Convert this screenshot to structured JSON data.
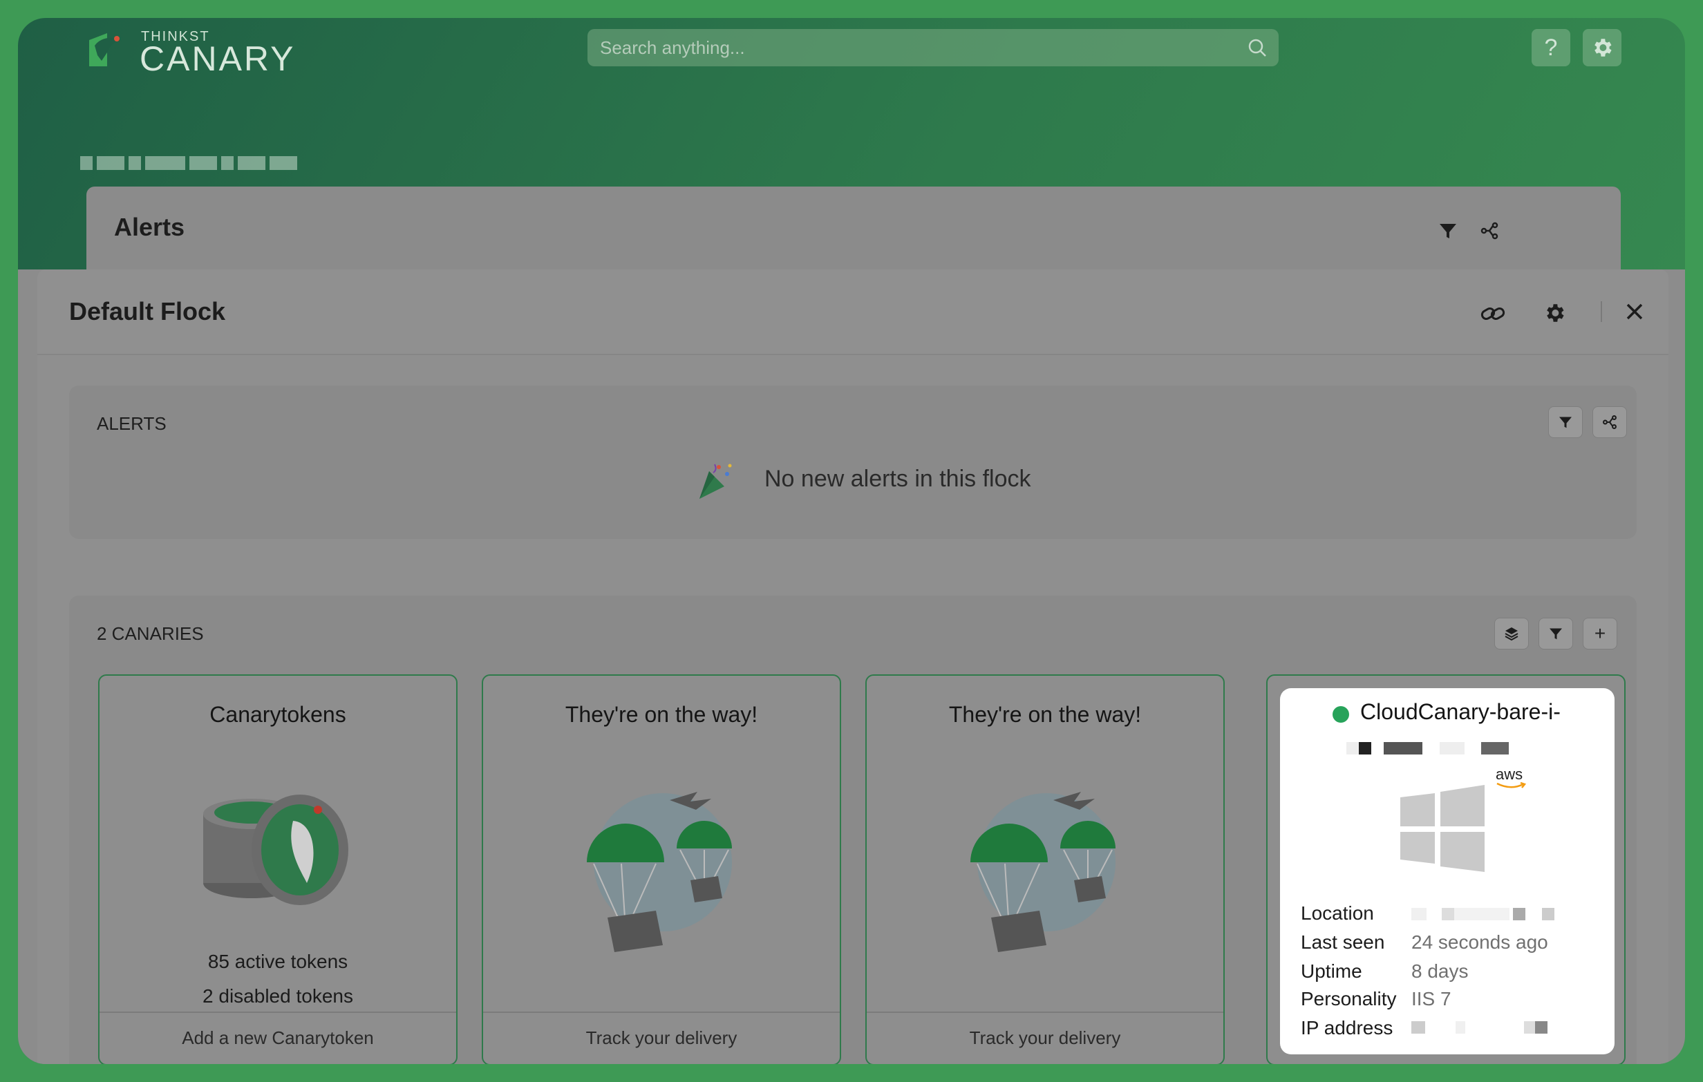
{
  "header": {
    "logo_small": "THINKST",
    "logo_big": "CANARY",
    "search_placeholder": "Search anything...",
    "help_label": "?"
  },
  "alerts_panel": {
    "title": "Alerts"
  },
  "modal": {
    "title": "Default Flock",
    "alerts_section": {
      "label": "ALERTS",
      "empty_message": "No new alerts in this flock"
    },
    "canaries_section": {
      "label": "2 CANARIES",
      "add_label": "+",
      "cards": [
        {
          "title": "Canarytokens",
          "stat1": "85 active tokens",
          "stat2": "2 disabled tokens",
          "footer": "Add a new Canarytoken"
        },
        {
          "title": "They're on the way!",
          "footer": "Track your delivery"
        },
        {
          "title": "They're on the way!",
          "footer": "Track your delivery"
        }
      ],
      "live_card": {
        "name": "CloudCanary-bare-i-",
        "status_color": "#27a35a",
        "provider_label": "aws",
        "fields": [
          {
            "key": "Location",
            "value": ""
          },
          {
            "key": "Last seen",
            "value": "24 seconds ago"
          },
          {
            "key": "Uptime",
            "value": "8 days"
          },
          {
            "key": "Personality",
            "value": "IIS 7"
          },
          {
            "key": "IP address",
            "value": ""
          }
        ]
      }
    }
  },
  "colors": {
    "brand_green": "#2f7a4b",
    "status_online": "#27a35a"
  }
}
